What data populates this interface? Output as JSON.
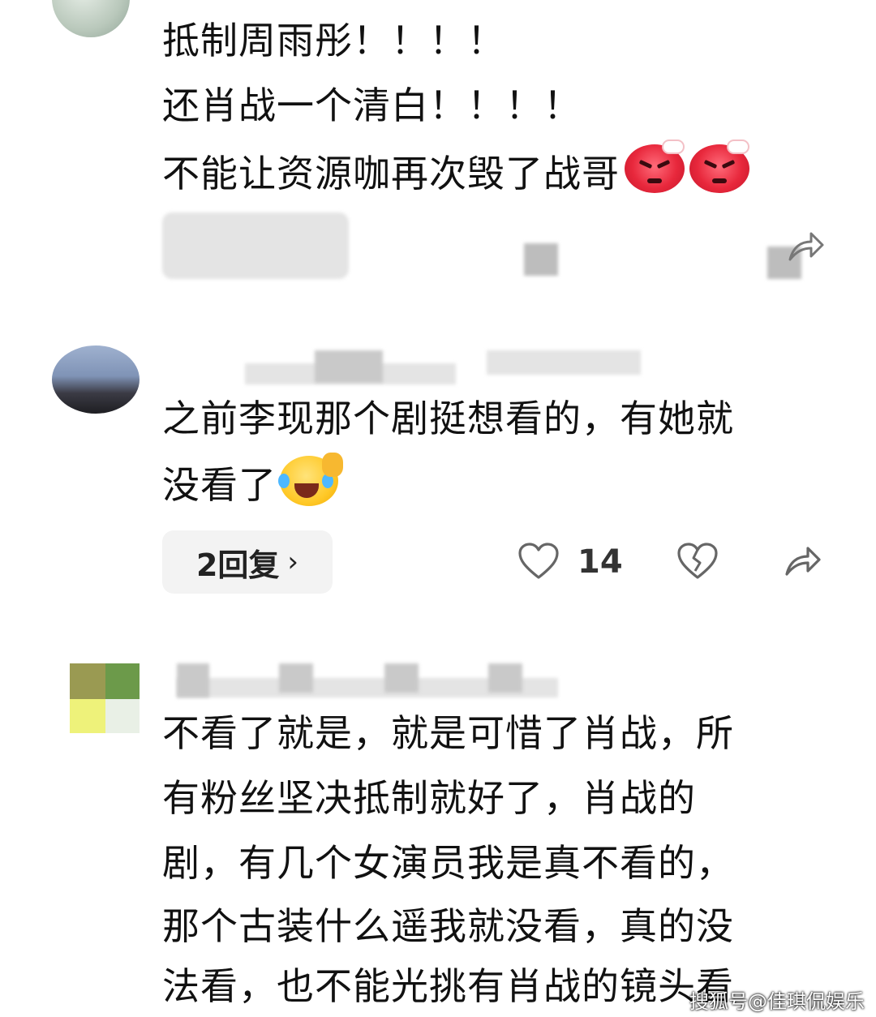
{
  "comment1": {
    "lines": [
      "抵制周雨彤！！！！",
      "还肖战一个清白！！！！",
      "不能让资源咖再次毁了战哥"
    ],
    "emojis": [
      "angry-emoji",
      "angry-emoji"
    ]
  },
  "comment2": {
    "lines": [
      "之前李现那个剧挺想看的，有她就",
      "没看了"
    ],
    "emoji": "laughing-crying-emoji",
    "reply_label": "2回复",
    "like_count": "14"
  },
  "comment3": {
    "lines": [
      "不看了就是，就是可惜了肖战，所",
      "有粉丝坚决抵制就好了，肖战的",
      "剧，有几个女演员我是真不看的，",
      "那个古装什么遥我就没看，真的没",
      "法看，也不能光挑有肖战的镜头看"
    ]
  },
  "watermark": "搜狐号@佳琪侃娱乐",
  "colors": {
    "text": "#111111",
    "icon": "#666666",
    "reply_bg": "#f3f3f3"
  }
}
